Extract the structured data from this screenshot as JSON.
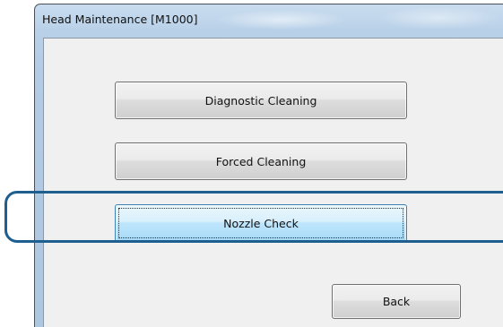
{
  "window": {
    "title": "Head Maintenance [M1000]"
  },
  "buttons": {
    "diagnostic_cleaning": "Diagnostic Cleaning",
    "forced_cleaning": "Forced Cleaning",
    "nozzle_check": "Nozzle Check",
    "back": "Back"
  },
  "highlight": {
    "target": "Nozzle Check",
    "color": "#1f5f8f"
  },
  "colors": {
    "title_bar": "#b3cbe4",
    "client_background": "#f0f0f0",
    "focused_button": "#bee6fd"
  }
}
